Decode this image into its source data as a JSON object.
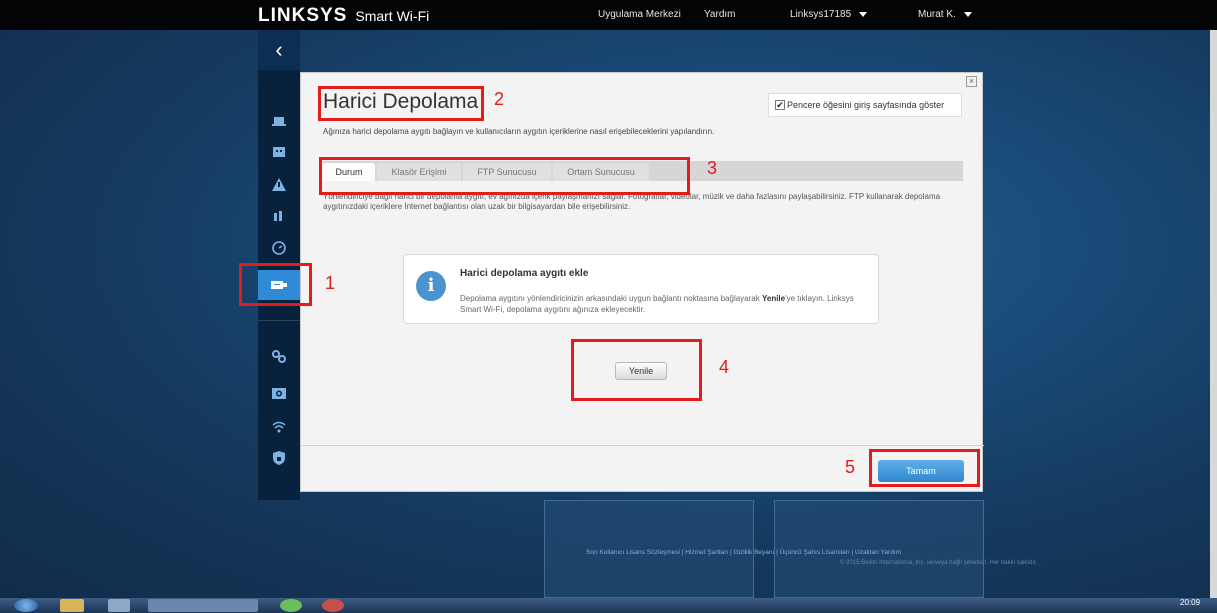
{
  "header": {
    "brand": "LINKSYS",
    "brand_sub": "Smart Wi-Fi",
    "nav": {
      "app_center": "Uygulama Merkezi",
      "help": "Yardım",
      "router": "Linksys17185",
      "user": "Murat K."
    }
  },
  "sidebar": {
    "collapse_glyph": "‹",
    "icons": [
      "laptop-icon",
      "parental-icon",
      "warning-icon",
      "priority-icon",
      "speed-icon",
      "usb-storage-icon",
      "settings-icon",
      "camera-icon",
      "wifi-icon",
      "security-icon"
    ],
    "active": "usb-storage-icon"
  },
  "modal": {
    "title": "Harici Depolama",
    "description": "Ağınıza harici depolama aygıtı bağlayın ve kullanıcıların aygıtın içeriklerine nasıl erişebileceklerini yapılandırın.",
    "show_on_start": "Pencere öğesini giriş sayfasında göster",
    "show_on_start_checked": true,
    "tabs": [
      "Durum",
      "Klasör Erişimi",
      "FTP Sunucusu",
      "Ortam Sunucusu"
    ],
    "active_tab": "Durum",
    "intro": "Yönlendiriciye bağlı harici bir depolama aygıtı, ev ağınızda içerik paylaşmanızı sağlar. Fotoğraflar, videolar, müzik ve daha fazlasını paylaşabilirsiniz. FTP kullanarak depolama aygıtınızdaki içeriklere İnternet bağlantısı olan uzak bir bilgisayardan bile erişebilirsiniz.",
    "notice": {
      "title": "Harici depolama aygıtı ekle",
      "body_before": "Depolama aygıtını yönlendiricinizin arkasındaki uygun bağlantı noktasına bağlayarak ",
      "body_bold": "Yenile",
      "body_after": "'ye tıklayın. Linksys Smart Wi-Fi, depolama aygıtını ağınıza ekleyecektir."
    },
    "refresh_label": "Yenile",
    "ok_label": "Tamam"
  },
  "annotations": [
    "1",
    "2",
    "3",
    "4",
    "5"
  ],
  "background": {
    "legal_links": "Son Kullanıcı Lisans Sözleşmesi | Hizmet Şartları | Gizlilik Beyanı | Üçüncü Şahıs Lisansları | Uzaktan Yardım",
    "copyright": "© 2015 Belkin International, Inc. ve/veya bağlı şirketleri. Her hakkı saklıdır."
  },
  "taskbar": {
    "time": "20:09"
  },
  "colors": {
    "annotation_red": "#e21b1b",
    "accent_blue": "#2f8bd6"
  }
}
